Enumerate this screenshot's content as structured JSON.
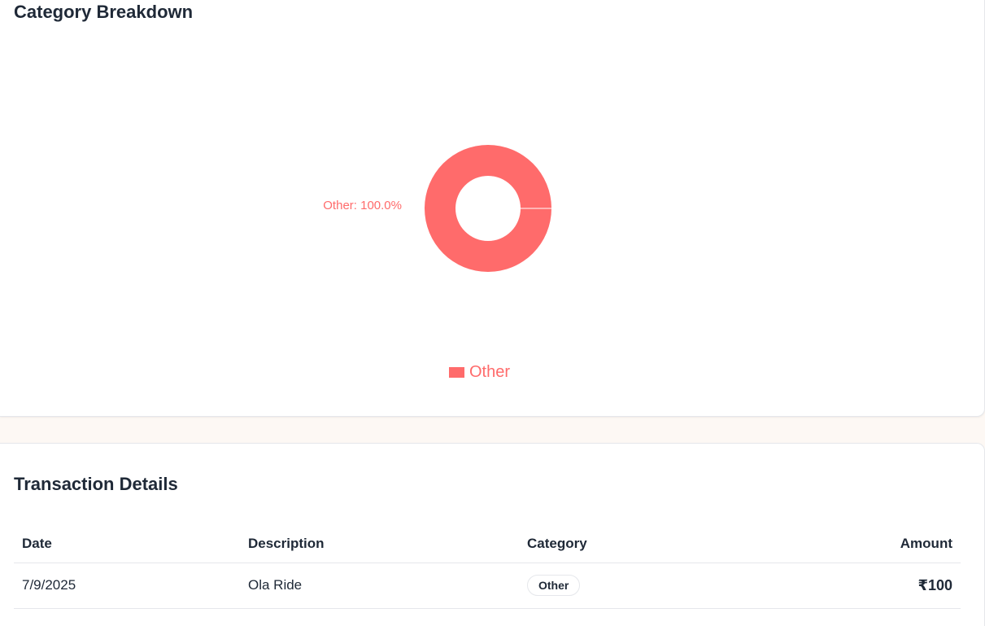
{
  "breakdown": {
    "title": "Category Breakdown"
  },
  "chart_data": {
    "type": "pie",
    "donut": true,
    "slices": [
      {
        "label": "Other",
        "value": 100.0,
        "color": "#ff6b6b",
        "data_label": "Other: 100.0%"
      }
    ],
    "legend": {
      "placement": "bottom-center",
      "entries": [
        {
          "label": "Other",
          "color": "#ff6b6b"
        }
      ]
    }
  },
  "transactions": {
    "title": "Transaction Details",
    "columns": {
      "date": "Date",
      "description": "Description",
      "category": "Category",
      "amount": "Amount"
    },
    "rows": [
      {
        "date": "7/9/2025",
        "description": "Ola Ride",
        "category": "Other",
        "amount": "₹100"
      }
    ]
  }
}
